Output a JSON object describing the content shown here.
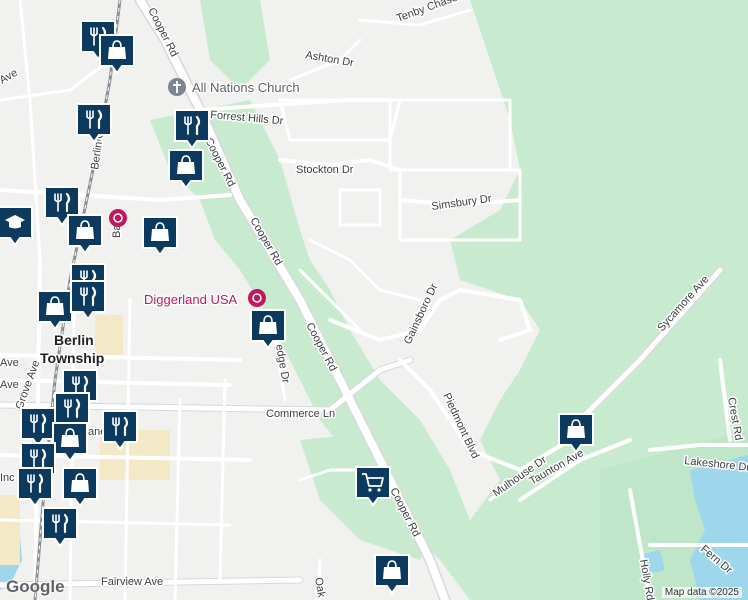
{
  "map": {
    "colors": {
      "land": "#f1f1ef",
      "park": "#c8ebd0",
      "road": "#ffffff",
      "road_outline": "#d5d8dc",
      "water": "#9ed7ec",
      "rail": "#8a8f96",
      "marker": "#0b3a5e",
      "marker_border": "#ffffff",
      "poi_text": "#c2185b"
    },
    "poi": {
      "church": {
        "label": "All Nations Church",
        "icon": "church-cross-icon"
      },
      "diggerland": {
        "label": "Diggerland USA",
        "icon": "amusement-park-icon"
      }
    },
    "town_label": [
      "Berlin",
      "Township"
    ],
    "street_labels": [
      "Cooper Rd",
      "Cooper Rd",
      "Cooper Rd",
      "Cooper Rd",
      "Cooper Rd",
      "Ashton Dr",
      "Tenby Chase",
      "Forrest Hills Dr",
      "Stockton Dr",
      "Simsbury Dr",
      "Gainsboro Dr",
      "Piedmont Blvd",
      "Sycamore Ave",
      "Crest Rd",
      "Lakeshore Dr",
      "Taunton Ave",
      "Mulhouse Dr",
      "Commerce Ln",
      "Fairview Ave",
      "Grove Ave",
      "Fern Dr",
      "Holly Rd",
      "Oak",
      "Bate",
      "Berlin Cross",
      "Ave",
      "Ave",
      "Ave",
      "Inc",
      "ane",
      "edge Dr"
    ],
    "attribution": "Map data ©2025",
    "logo": "Google"
  },
  "markers": [
    {
      "type": "restaurant",
      "icon": "fork-knife-icon"
    },
    {
      "type": "shopping",
      "icon": "shopping-bag-icon"
    },
    {
      "type": "restaurant",
      "icon": "fork-knife-icon"
    },
    {
      "type": "restaurant",
      "icon": "fork-knife-icon"
    },
    {
      "type": "shopping",
      "icon": "shopping-bag-icon"
    },
    {
      "type": "school",
      "icon": "graduation-cap-icon"
    },
    {
      "type": "restaurant",
      "icon": "fork-knife-icon"
    },
    {
      "type": "shopping",
      "icon": "shopping-bag-icon"
    },
    {
      "type": "shopping",
      "icon": "shopping-bag-icon"
    },
    {
      "type": "restaurant",
      "icon": "fork-knife-icon"
    },
    {
      "type": "shopping",
      "icon": "shopping-bag-icon"
    },
    {
      "type": "restaurant",
      "icon": "fork-knife-icon"
    },
    {
      "type": "shopping",
      "icon": "shopping-bag-icon"
    },
    {
      "type": "restaurant",
      "icon": "fork-knife-icon"
    },
    {
      "type": "restaurant",
      "icon": "fork-knife-icon"
    },
    {
      "type": "restaurant",
      "icon": "fork-knife-icon"
    },
    {
      "type": "restaurant",
      "icon": "fork-knife-icon"
    },
    {
      "type": "shopping",
      "icon": "shopping-bag-icon"
    },
    {
      "type": "restaurant",
      "icon": "fork-knife-icon"
    },
    {
      "type": "restaurant",
      "icon": "fork-knife-icon"
    },
    {
      "type": "shopping",
      "icon": "shopping-bag-icon"
    },
    {
      "type": "restaurant",
      "icon": "fork-knife-icon"
    },
    {
      "type": "grocery",
      "icon": "shopping-cart-icon"
    },
    {
      "type": "shopping",
      "icon": "shopping-bag-icon"
    },
    {
      "type": "shopping",
      "icon": "shopping-bag-icon"
    }
  ]
}
